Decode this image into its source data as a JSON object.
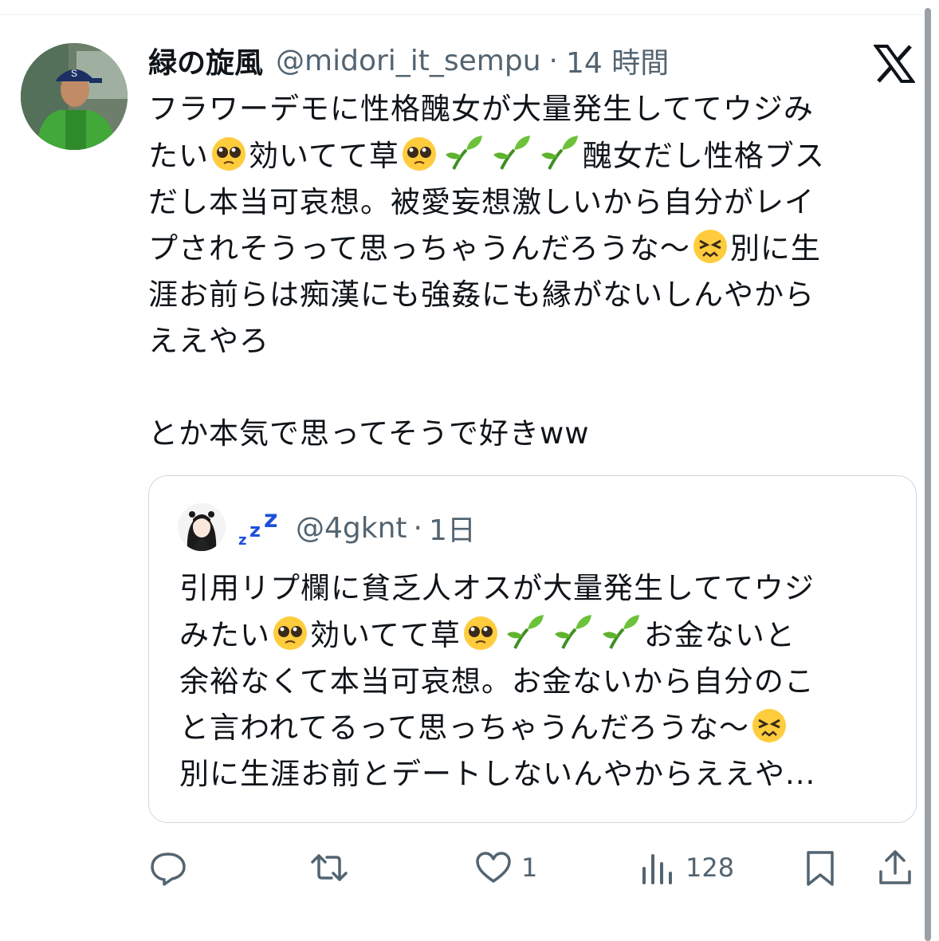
{
  "tweet": {
    "display_name": "緑の旋風",
    "handle": "@midori_it_sempu",
    "separator": "·",
    "time": "14 時間",
    "text_lines": [
      "フラワーデモに性格醜女が大量発生しててウジみ",
      "たい",
      "効いてて草",
      "醜女だし性格ブス",
      "だし本当可哀想。被愛妄想激しいから自分がレイ",
      "プされそうって思っちゃうんだろうな〜",
      "別に生",
      "涯お前らは痴漢にも強姦にも縁がないしんやから",
      "ええやろ",
      "とか本気で思ってそうで好きww"
    ]
  },
  "quote": {
    "handle": "@4gknt",
    "separator": "·",
    "time": "1日",
    "text_lines": [
      "引用リプ欄に貧乏人オスが大量発生しててウジ",
      "みたい",
      "効いてて草",
      "お金ないと",
      "余裕なくて本当可哀想。お金ないから自分のこ",
      "と言われてるって思っちゃうんだろうな〜",
      "別に生涯お前とデートしないんやからええや..."
    ]
  },
  "actions": {
    "reply_count": "",
    "retweet_count": "",
    "like_count": "1",
    "view_count": "128"
  },
  "colors": {
    "text": "#0f1419",
    "muted": "#536471",
    "border": "#cfd9de",
    "zzz_blue": "#1d4fd8",
    "sprout_green": "#55b030"
  },
  "icons": [
    "x-logo-icon",
    "pleading-face-emoji",
    "seedling-emoji",
    "persevering-face-emoji",
    "zzz-emoji",
    "reply-icon",
    "retweet-icon",
    "like-icon",
    "views-icon",
    "bookmark-icon",
    "share-icon"
  ]
}
